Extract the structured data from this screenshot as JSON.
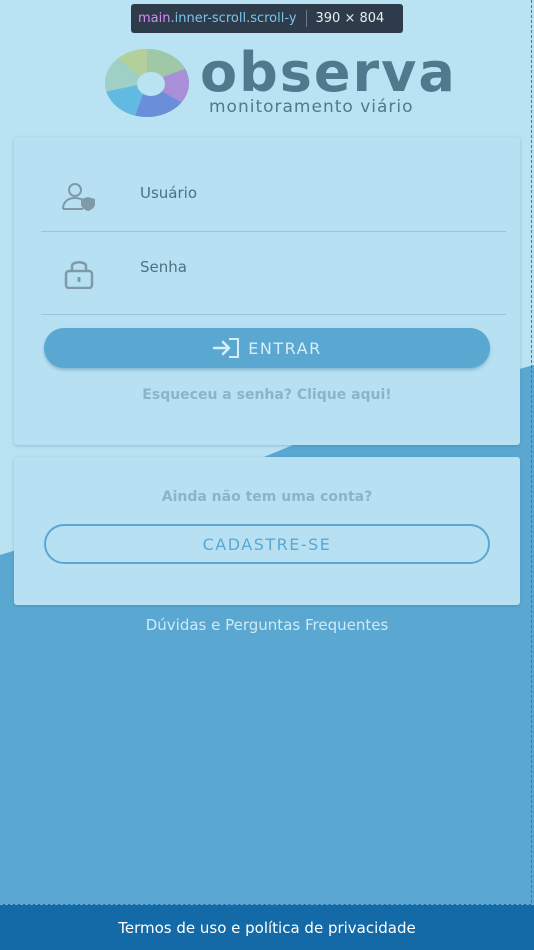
{
  "devtools": {
    "tag": "main",
    "classes": ".inner-scroll.scroll-y",
    "size": "390 × 804"
  },
  "logo": {
    "word": "observa",
    "subtitle": "monitoramento viário"
  },
  "login": {
    "user_label": "Usuário",
    "password_label": "Senha",
    "enter_label": "ENTRAR",
    "forgot_link": "Esqueceu a senha? Clique aqui!"
  },
  "signup": {
    "prompt": "Ainda não tem uma conta?",
    "button_label": "CADASTRE-SE"
  },
  "faq_link": "Dúvidas e Perguntas Frequentes",
  "footer": {
    "terms_link": "Termos de uso e política de privacidade"
  },
  "icons": {
    "user": "user-shield-icon",
    "password": "lock-icon",
    "enter": "login-arrow-icon"
  },
  "colors": {
    "background_light": "#b9e2f2",
    "background_wave": "#5aa8d1",
    "primary": "#5aa8d1",
    "footer": "#136aa7"
  }
}
